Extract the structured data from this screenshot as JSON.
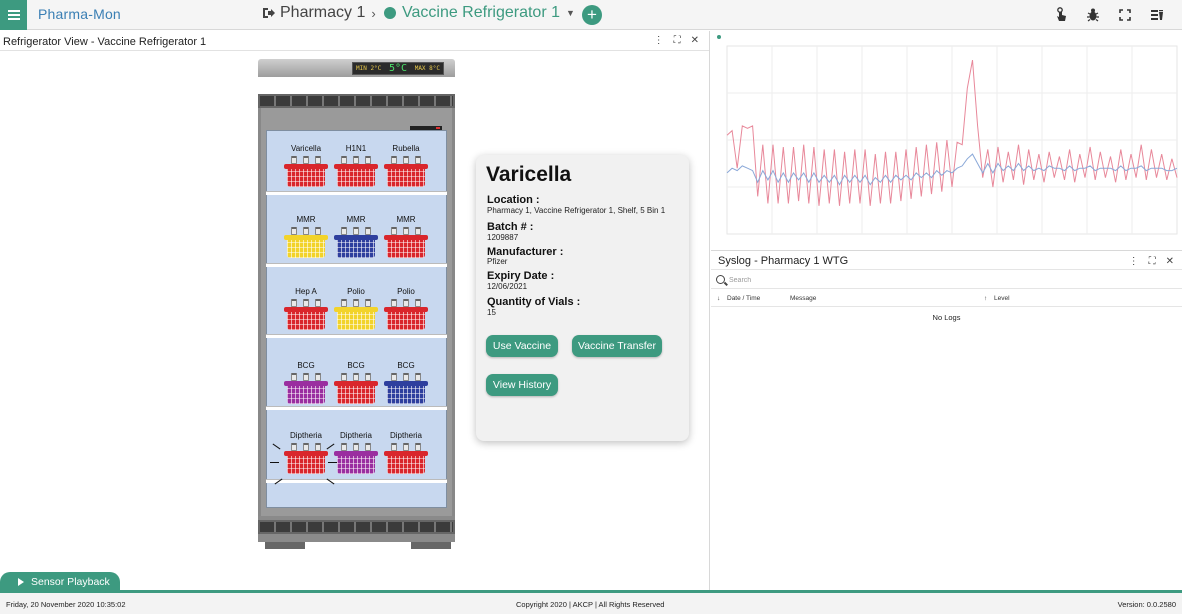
{
  "app": {
    "logo_text": "Pharma-Mon"
  },
  "breadcrumb": {
    "site": "Pharmacy 1",
    "device": "Vaccine Refrigerator 1",
    "device_status_color": "#3d9a80"
  },
  "left_panel": {
    "title": "Refrigerator View - Vaccine Refrigerator 1"
  },
  "fridge": {
    "display": {
      "min": "MIN 2°C",
      "temp": "5°C",
      "max": "MAX 8°C"
    },
    "shelves": [
      {
        "bins": [
          {
            "name": "Varicella",
            "color": "#d9262c"
          },
          {
            "name": "H1N1",
            "color": "#d9262c"
          },
          {
            "name": "Rubella",
            "color": "#d9262c"
          }
        ]
      },
      {
        "bins": [
          {
            "name": "MMR",
            "color": "#f2d32a"
          },
          {
            "name": "MMR",
            "color": "#2e3f9e"
          },
          {
            "name": "MMR",
            "color": "#d9262c"
          }
        ]
      },
      {
        "bins": [
          {
            "name": "Hep A",
            "color": "#d9262c"
          },
          {
            "name": "Polio",
            "color": "#f2d32a"
          },
          {
            "name": "Polio",
            "color": "#d9262c"
          }
        ]
      },
      {
        "bins": [
          {
            "name": "BCG",
            "color": "#9a2ea0"
          },
          {
            "name": "BCG",
            "color": "#d9262c"
          },
          {
            "name": "BCG",
            "color": "#2e3f9e"
          }
        ]
      },
      {
        "bins": [
          {
            "name": "Diptheria",
            "color": "#d9262c"
          },
          {
            "name": "Diptheria",
            "color": "#9a2ea0"
          },
          {
            "name": "Diptheria",
            "color": "#d9262c"
          }
        ]
      }
    ]
  },
  "detail": {
    "title": "Varicella",
    "location_label": "Location :",
    "location_value": "Pharmacy 1, Vaccine Refrigerator 1, Shelf, 5 Bin 1",
    "batch_label": "Batch # :",
    "batch_value": "1209887",
    "manufacturer_label": "Manufacturer :",
    "manufacturer_value": "Pfizer",
    "expiry_label": "Expiry Date :",
    "expiry_value": "12/06/2021",
    "quantity_label": "Quantity of Vials :",
    "quantity_value": "15",
    "use_vaccine_label": "Use Vaccine",
    "transfer_label": "Vaccine Transfer",
    "history_label": "View History"
  },
  "playback": {
    "label": "Sensor Playback"
  },
  "syslog": {
    "title": "Syslog - Pharmacy 1 WTG",
    "search_placeholder": "Search",
    "columns": [
      "Date / Time",
      "Message",
      "Level"
    ],
    "empty_text": "No Logs"
  },
  "footer": {
    "datetime": "Friday, 20 November 2020 10:35:02",
    "copyright": "Copyright 2020 | AKCP | All Rights Reserved",
    "version": "Version: 0.0.2580"
  },
  "chart_data": {
    "type": "line",
    "legend": "top-left",
    "series": [
      {
        "name": "",
        "color": "#e8889a",
        "values": [
          5.2,
          5.4,
          3.8,
          5.6,
          5.5,
          5.6,
          2.6,
          4.8,
          2.3,
          4.8,
          2.3,
          4.7,
          2.3,
          4.7,
          2.4,
          4.8,
          2.3,
          4.7,
          2.2,
          4.6,
          2.3,
          4.6,
          2.2,
          4.5,
          2.3,
          4.6,
          2.3,
          4.6,
          2.2,
          4.4,
          2.3,
          4.5,
          2.3,
          4.5,
          2.4,
          4.6,
          2.5,
          4.7,
          2.6,
          4.8,
          2.7,
          4.9,
          2.8,
          5.0,
          3.0,
          4.9,
          4.8,
          7.2,
          8.4,
          5.6,
          3.4,
          4.6,
          3.0,
          4.7,
          3.2,
          4.5,
          3.3,
          4.8,
          3.1,
          4.6,
          3.3,
          4.4,
          3.2,
          4.5,
          3.4,
          4.3,
          3.3,
          4.6,
          3.2,
          4.4,
          3.4,
          4.7,
          3.3,
          4.5,
          3.4,
          4.3,
          3.2,
          4.6,
          3.3,
          4.4,
          3.4,
          4.8,
          3.3,
          4.6,
          3.4,
          4.4,
          3.3,
          4.2,
          3.4
        ]
      },
      {
        "name": "",
        "color": "#8aa8d8",
        "values": [
          3.6,
          3.8,
          3.7,
          3.9,
          3.8,
          3.7,
          3.2,
          3.7,
          3.3,
          3.7,
          3.2,
          3.6,
          3.2,
          3.6,
          3.3,
          3.6,
          3.2,
          3.6,
          3.2,
          3.5,
          3.2,
          3.5,
          3.1,
          3.5,
          3.2,
          3.5,
          3.2,
          3.5,
          3.1,
          3.4,
          3.2,
          3.5,
          3.2,
          3.5,
          3.3,
          3.5,
          3.3,
          3.6,
          3.4,
          3.6,
          3.4,
          3.7,
          3.5,
          3.7,
          3.6,
          3.8,
          3.9,
          4.2,
          4.4,
          4.0,
          3.6,
          4.0,
          3.6,
          4.0,
          3.7,
          3.9,
          3.7,
          4.0,
          3.7,
          3.9,
          3.7,
          3.8,
          3.7,
          3.9,
          3.8,
          3.8,
          3.7,
          3.9,
          3.7,
          3.8,
          3.8,
          3.9,
          3.7,
          3.8,
          3.8,
          3.8,
          3.7,
          3.9,
          3.7,
          3.8,
          3.8,
          3.9,
          3.7,
          3.8,
          3.8,
          3.8,
          3.7,
          3.7,
          3.8
        ]
      }
    ],
    "ylim": [
      1,
      9
    ]
  }
}
